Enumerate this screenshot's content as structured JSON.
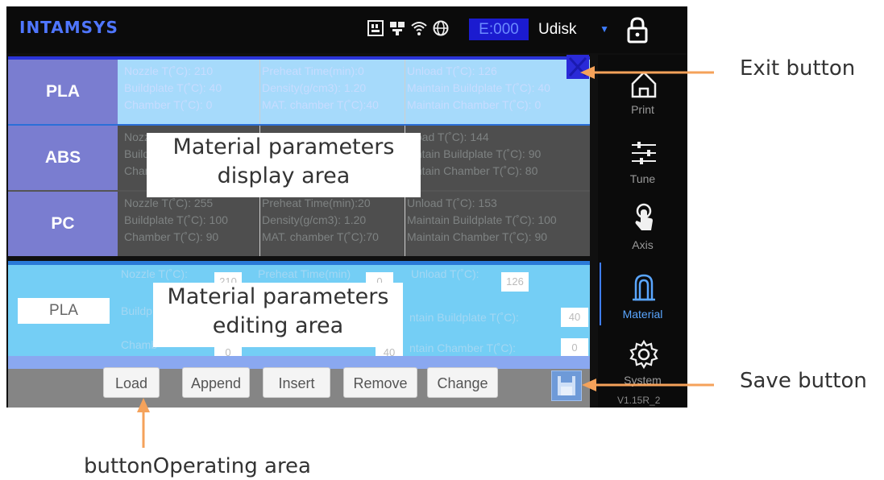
{
  "header": {
    "logo": "INTAMSYS",
    "error_code": "E:000",
    "storage_select": "Udisk",
    "status_icons": [
      "sd-card-icon",
      "network-icon",
      "wifi-icon",
      "globe-icon"
    ],
    "lock_icon": "lock-icon"
  },
  "materials": [
    {
      "name": "PLA",
      "col1": [
        "Nozzle T(˚C):      210",
        "Buildplate T(˚C):  40",
        "Chamber T(˚C):   0"
      ],
      "col2": [
        "Preheat Time(min):0",
        "Density(g/cm3):     1.20",
        "MAT. chamber T(˚C):40"
      ],
      "col3": [
        "Unload T(˚C):     126",
        "Maintain Buildplate T(˚C): 40",
        "Maintain Chamber T(˚C): 0"
      ]
    },
    {
      "name": "ABS",
      "col1": [
        "Nozzl",
        "Buildp",
        "Cham"
      ],
      "col2": [
        "",
        "",
        ""
      ],
      "col3": [
        "nload T(˚C):     144",
        "aintain Buildplate T(˚C): 90",
        "aintain Chamber T(˚C):  80"
      ]
    },
    {
      "name": "PC",
      "col1": [
        "Nozzle T(˚C):       255",
        "Buildplate T(˚C):  100",
        "Chamber T(˚C):    90"
      ],
      "col2": [
        "Preheat Time(min):20",
        "Density(g/cm3):     1.20",
        "MAT. chamber T(˚C):70"
      ],
      "col3": [
        "Unload T(˚C):    153",
        "Maintain Buildplate T(˚C): 100",
        "Maintain Chamber T(˚C):  90"
      ]
    }
  ],
  "editor": {
    "name": "PLA",
    "labels": [
      "Nozzle T(˚C):",
      "Preheat Time(min)",
      "Unload T(˚C):",
      "Buildp",
      "ntain Buildplate T(˚C):",
      "Chamb",
      "ntain Chamber T(˚C):"
    ],
    "values": [
      "210",
      "0",
      "126",
      "40",
      "0",
      "40"
    ]
  },
  "buttons": {
    "load": "Load",
    "append": "Append",
    "insert": "Insert",
    "remove": "Remove",
    "change": "Change"
  },
  "sidebar": {
    "items": [
      {
        "label": "Print",
        "icon": "home-icon"
      },
      {
        "label": "Tune",
        "icon": "sliders-icon"
      },
      {
        "label": "Axis",
        "icon": "hand-pointer-icon"
      },
      {
        "label": "Material",
        "icon": "filament-icon"
      },
      {
        "label": "System",
        "icon": "gear-icon"
      }
    ],
    "version": "V1.15R_2"
  },
  "annotations": {
    "exit": "Exit button",
    "save": "Save button",
    "operating": "buttonOperating area",
    "display_line1": "Material parameters",
    "display_line2": "display area",
    "editing_line1": "Material parameters",
    "editing_line2": "editing area"
  },
  "colors": {
    "accent_blue": "#2a2ad8",
    "selected_row": "#a6dafb",
    "editor_bg": "#74cef5",
    "callout_arrow": "#f5a25a"
  }
}
